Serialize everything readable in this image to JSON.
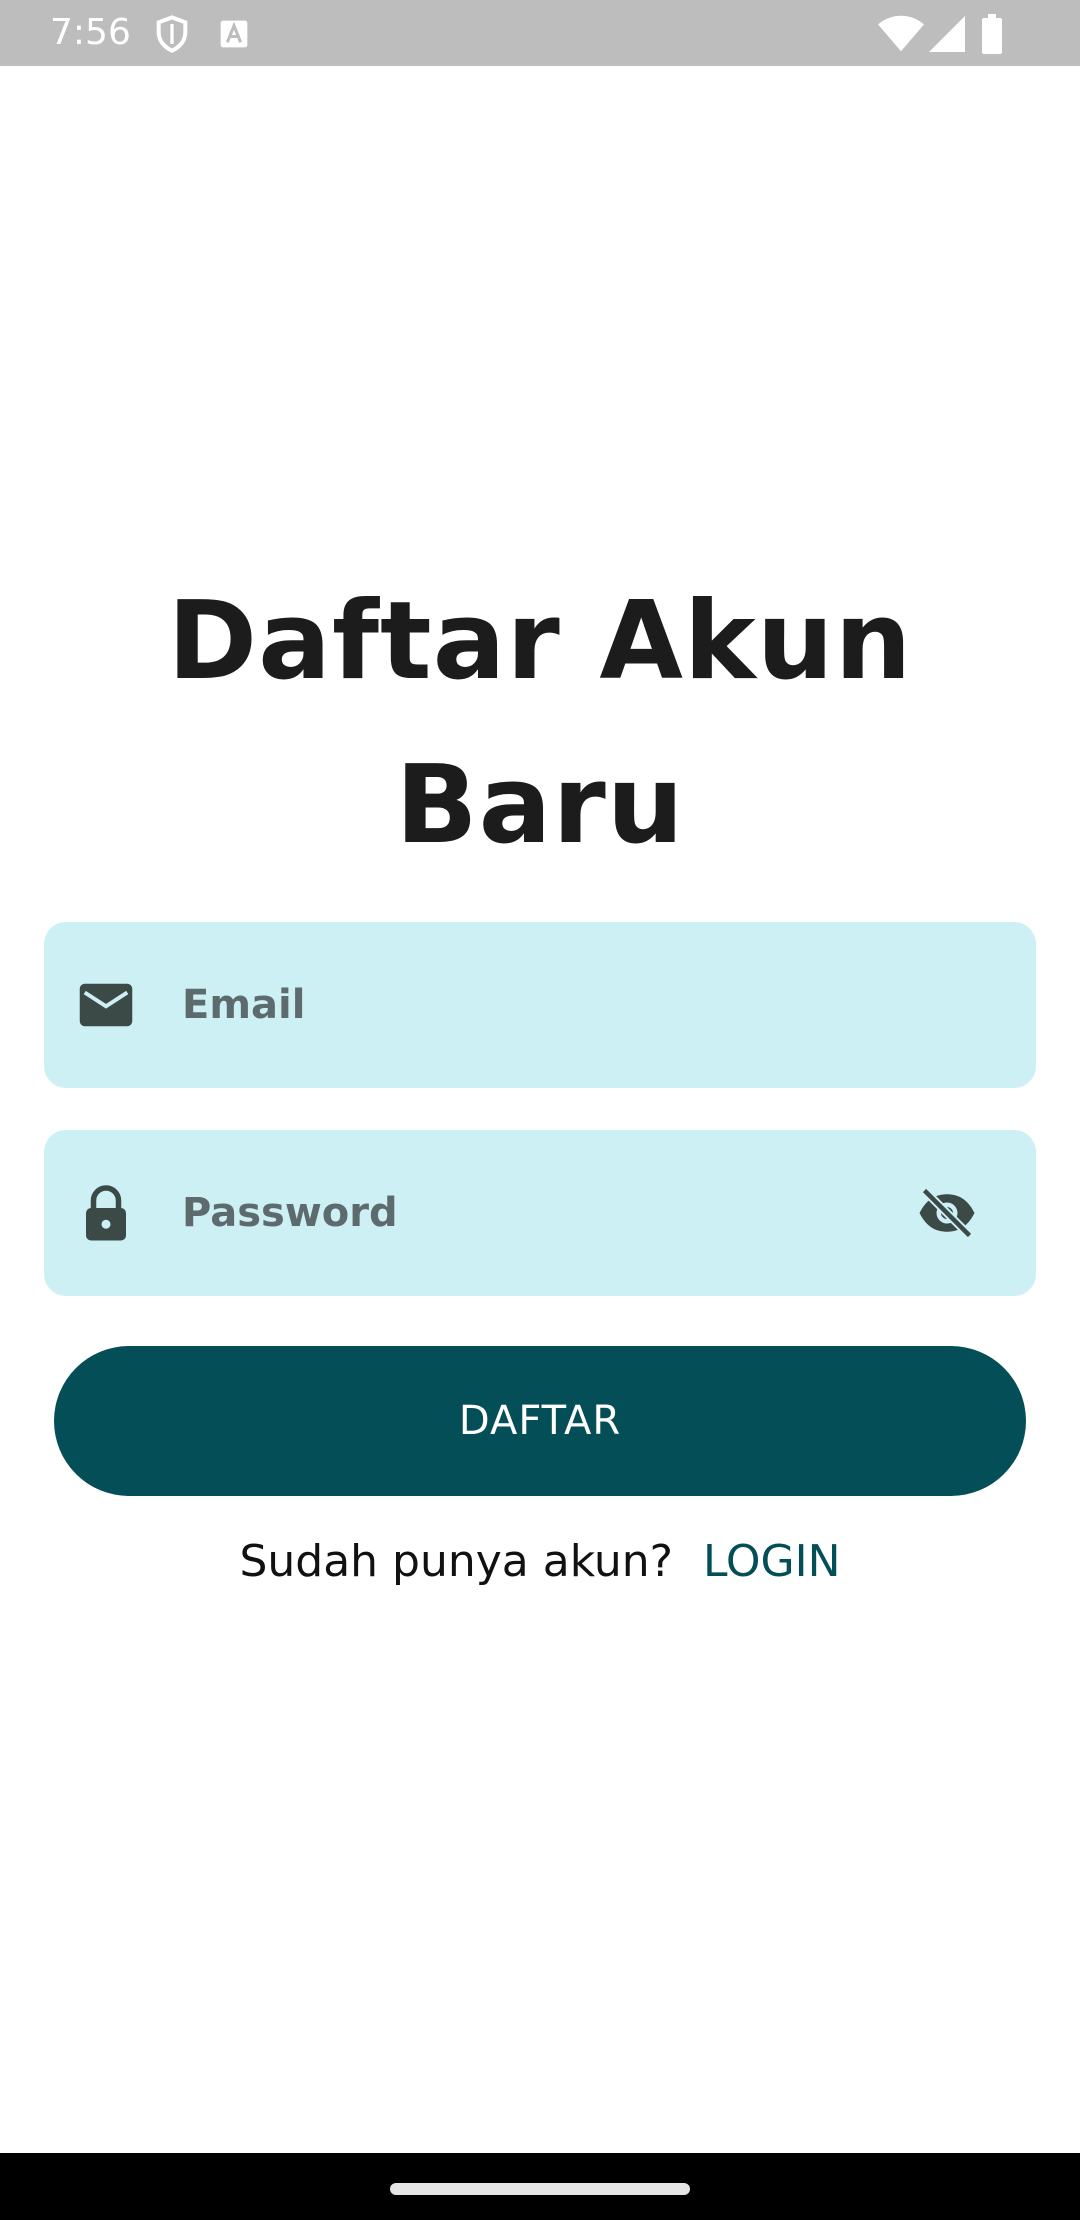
{
  "status_bar": {
    "time": "7:56",
    "icons": [
      "shield-icon",
      "keyboard-a-icon",
      "wifi-icon",
      "signal-icon",
      "battery-icon"
    ],
    "color": "#bdbdbd"
  },
  "page": {
    "title": "Daftar Akun Baru"
  },
  "form": {
    "email": {
      "placeholder": "Email",
      "icon": "mail-icon"
    },
    "password": {
      "placeholder": "Password",
      "icon": "lock-icon",
      "toggle_icon": "visibility-off-icon"
    },
    "field_color": "#cdf0f4"
  },
  "actions": {
    "register_label": "DAFTAR",
    "button_color": "#034e57"
  },
  "footer": {
    "prompt": "Sudah punya akun?",
    "login_label": "LOGIN"
  }
}
